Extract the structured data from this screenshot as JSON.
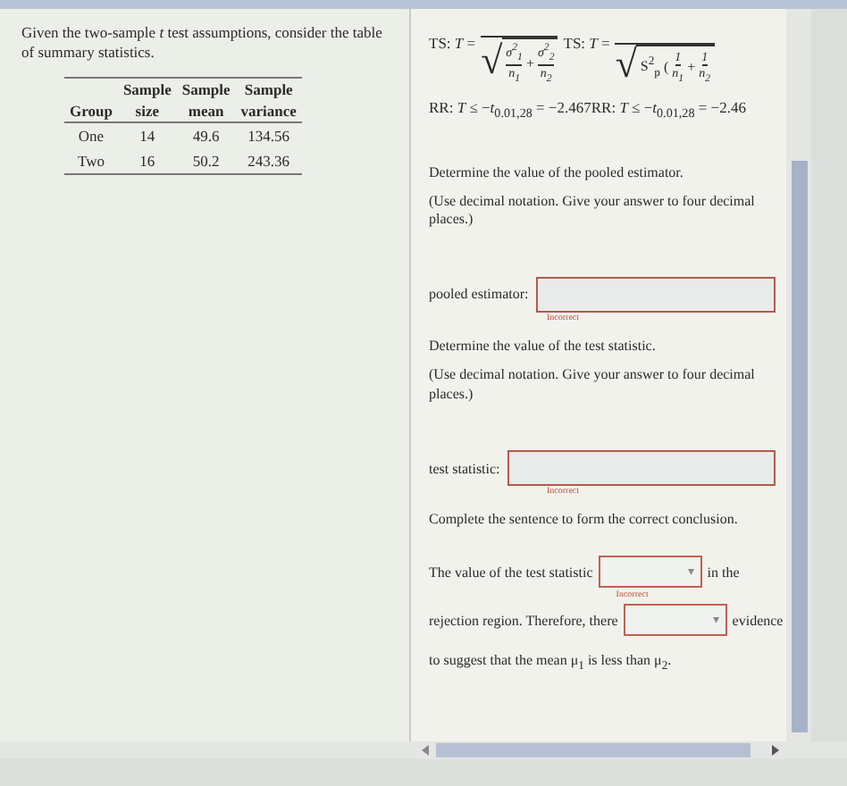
{
  "intro": "Given the two-sample *t* test assumptions, consider the table of summary statistics.",
  "table": {
    "header_top": [
      "Sample",
      "Sample",
      "Sample"
    ],
    "columns": [
      "Group",
      "size",
      "mean",
      "variance"
    ],
    "rows": [
      [
        "One",
        "14",
        "49.6",
        "134.56"
      ],
      [
        "Two",
        "16",
        "50.2",
        "243.36"
      ]
    ]
  },
  "formulas": [
    {
      "label": "TS: *T* =",
      "radical": "√",
      "plus": "+",
      "terms": [
        {
          "num": "σ$^{2}$$_{1}$",
          "den": "n$_{1}$"
        },
        {
          "num": "σ$^{2}$$_{2}$",
          "den": "n$_{2}$"
        }
      ]
    },
    {
      "label": "TS: *T* =",
      "radical": "√",
      "prefix": "S$^{2}$$_{p}$",
      "open": "(",
      "plus": "+",
      "terms": [
        {
          "num": "1",
          "den": "n$_{1}$"
        },
        {
          "num": "1",
          "den": "n$_{2}$"
        }
      ]
    }
  ],
  "rejection": "RR: *T* ≤ −*t*$_{0.01,28}$ = −2.467RR: *T* ≤ −*t*$_{0.01,28}$ = −2.46",
  "questions": [
    {
      "title": "Determine the value of the pooled estimator.",
      "note": "(Use decimal notation. Give your answer to four decimal places.)",
      "label": "pooled estimator:",
      "incorrect": true,
      "status": "Incorrect"
    },
    {
      "title": "Determine the value of the test statistic.",
      "note": "(Use decimal notation. Give your answer to four decimal places.)",
      "label": "test statistic:",
      "incorrect": true,
      "status": "Incorrect"
    }
  ],
  "conclusion": {
    "title": "Complete the sentence to form the correct conclusion.",
    "part1": "The value of the test statistic",
    "part2": "in the",
    "part3": "rejection region. Therefore, there",
    "part4": "evidence",
    "part5": "to suggest that the mean μ$_{1}$ is less than μ$_{2}$.",
    "caret": "▾",
    "status": "Incorrect",
    "dropdowns": [
      {
        "incorrect": true
      },
      {
        "incorrect": true
      }
    ]
  }
}
